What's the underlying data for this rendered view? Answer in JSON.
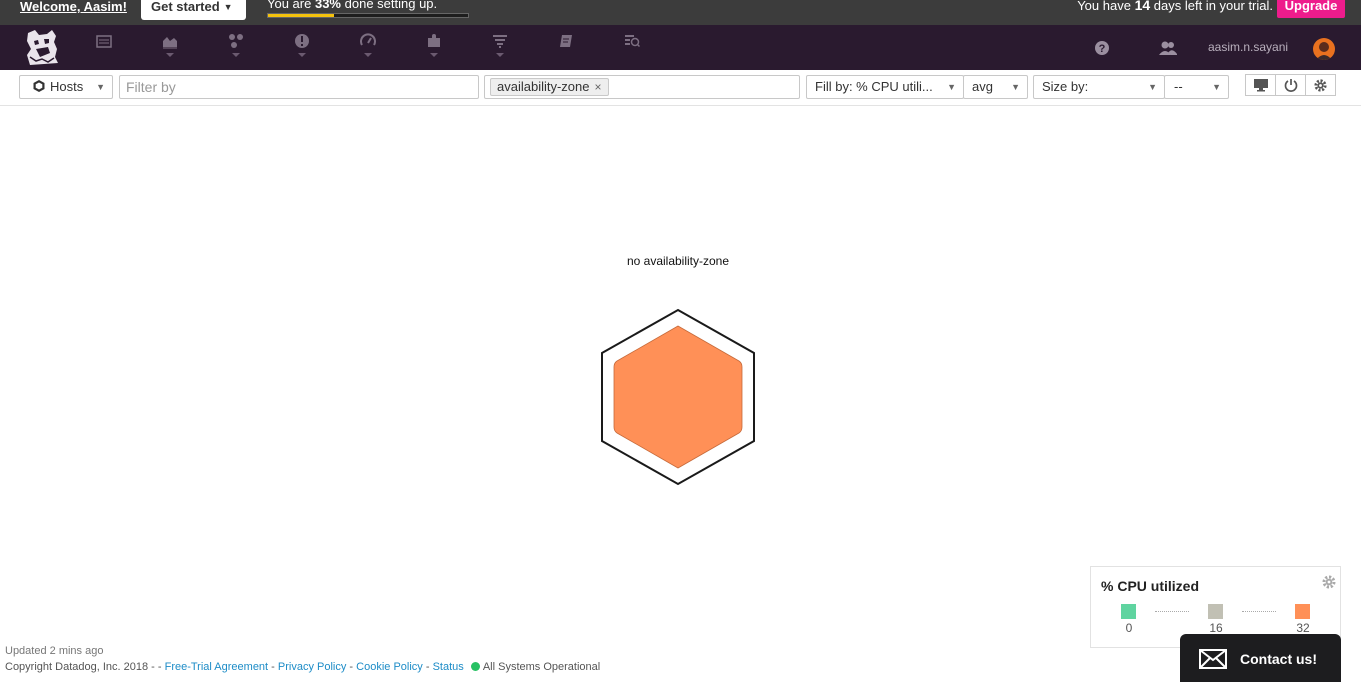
{
  "topbar": {
    "welcome": "Welcome, Aasim!",
    "get_started": "Get started",
    "setup_prefix": "You are",
    "setup_percent": "33%",
    "setup_suffix": "done setting up.",
    "setup_progress": 0.33,
    "trial_prefix": "You have",
    "trial_days": "14",
    "trial_suffix": "days left in your trial.",
    "upgrade": "Upgrade",
    "upgrade_color": "#ee1c8c",
    "progress_color": "#f4c20d"
  },
  "nav": {
    "items": [
      {
        "icon": "dashboard-icon"
      },
      {
        "icon": "metrics-chart-icon"
      },
      {
        "icon": "integrations-nodes-icon"
      },
      {
        "icon": "monitors-alert-icon"
      },
      {
        "icon": "apm-gauge-icon"
      },
      {
        "icon": "puzzle-icon"
      },
      {
        "icon": "logs-filter-icon"
      },
      {
        "icon": "notebook-icon"
      },
      {
        "icon": "watchdog-icon"
      }
    ],
    "help_icon": "help-icon",
    "team_icon": "team-icon",
    "username": "aasim.n.sayani"
  },
  "toolbar": {
    "hosts": "Hosts",
    "filter_placeholder": "Filter by",
    "group_tag": "availability-zone",
    "fill_by": "Fill by: % CPU utili...",
    "fill_agg": "avg",
    "size_by": "Size by:",
    "size_agg": "--"
  },
  "map": {
    "group_label": "no availability-zone",
    "host_fill_color": "#ff9057"
  },
  "legend": {
    "title": "% CPU utilized",
    "stops": [
      {
        "value": "0",
        "color": "#5fd4a0"
      },
      {
        "value": "16",
        "color": "#c1c0b4"
      },
      {
        "value": "32",
        "color": "#ff9057"
      }
    ]
  },
  "footer": {
    "updated": "Updated 2 mins ago",
    "copyright": "Copyright Datadog, Inc. 2018 - -",
    "links": [
      "Free-Trial Agreement",
      "Privacy Policy",
      "Cookie Policy",
      "Status"
    ],
    "status_text": "All Systems Operational",
    "status_color": "#27c163"
  },
  "contact": {
    "label": "Contact us!"
  }
}
